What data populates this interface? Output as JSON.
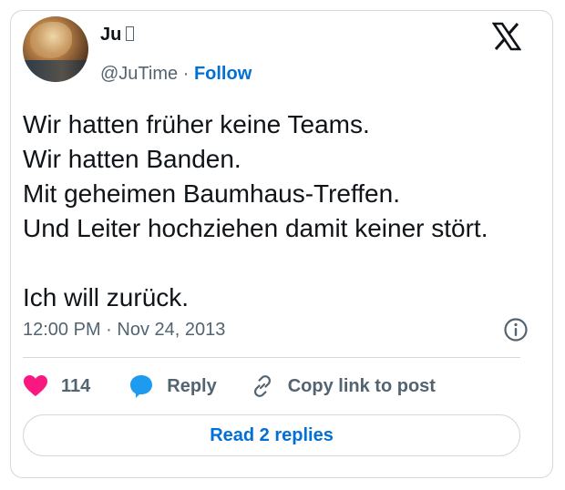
{
  "author": {
    "name": "Ju",
    "handle": "@JuTime",
    "separator": "·",
    "follow_label": "Follow"
  },
  "tweet": {
    "lines": [
      "Wir hatten früher keine Teams.",
      "Wir hatten Banden.",
      "Mit geheimen Baumhaus-Treffen.",
      "Und Leiter hochziehen damit keiner stört.",
      "",
      "Ich will zurück."
    ],
    "timestamp": "12:00 PM · Nov 24, 2013"
  },
  "actions": {
    "likes_count": "114",
    "reply_label": "Reply",
    "copy_link_label": "Copy link to post"
  },
  "replies_button_label": "Read 2 replies",
  "icons": {
    "platform": "x-logo-icon",
    "info": "info-icon",
    "like": "heart-icon",
    "reply": "speech-bubble-icon",
    "copy": "link-icon"
  },
  "colors": {
    "accent": "#006fd6",
    "like": "#f91880",
    "reply": "#1d9bf0",
    "text": "#0f1419",
    "secondary": "#536471",
    "border": "#cfd9de"
  }
}
